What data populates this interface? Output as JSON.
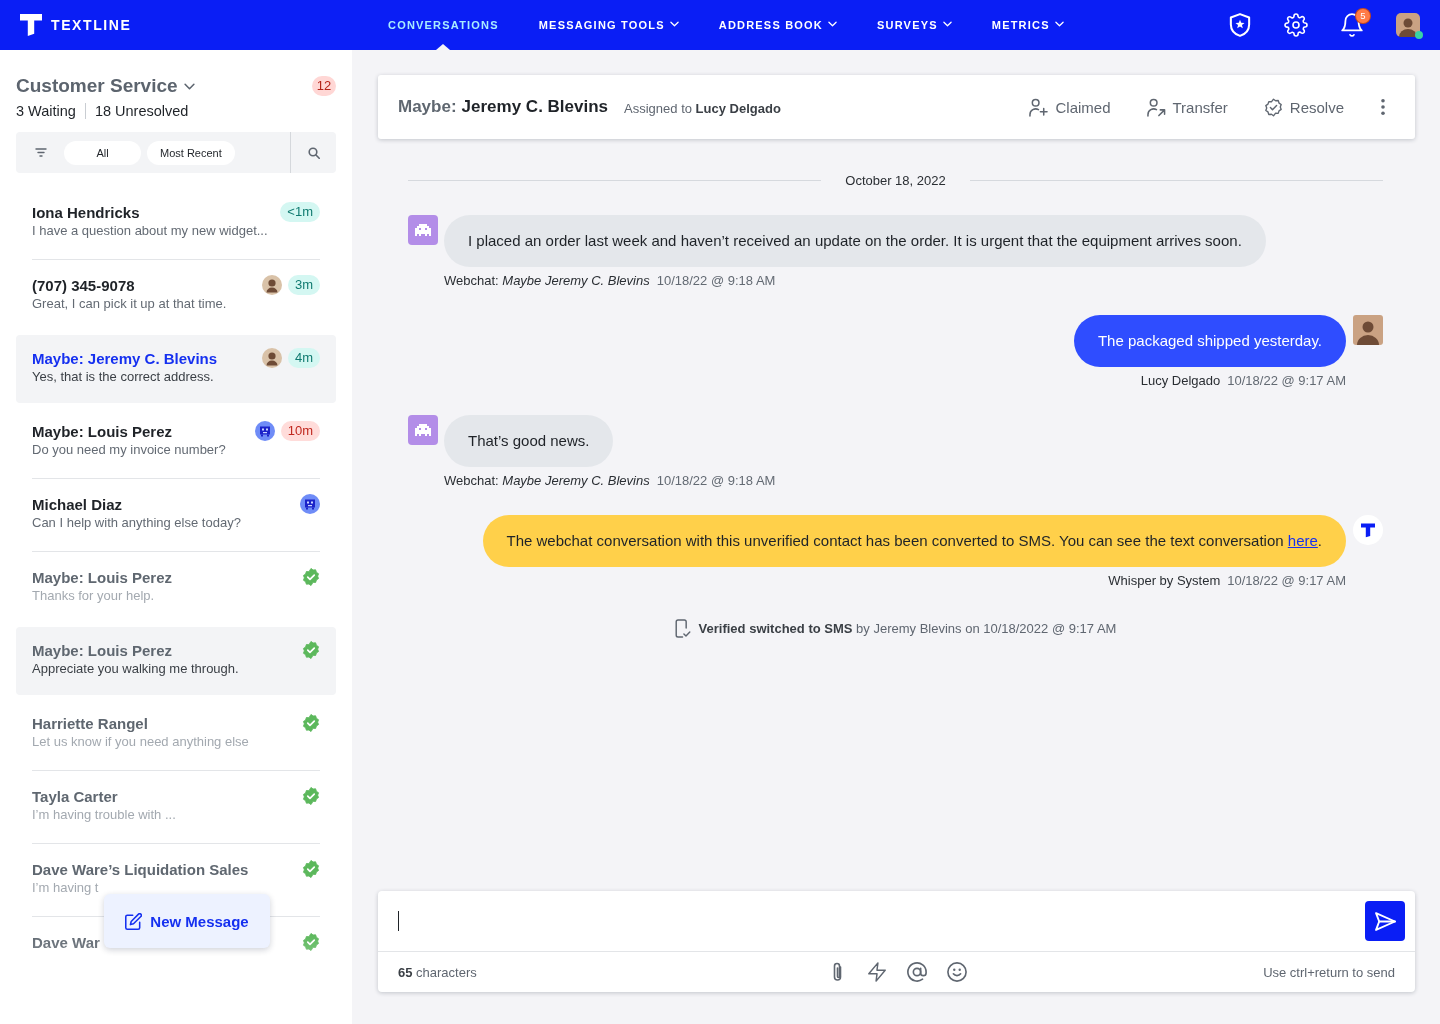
{
  "topbar": {
    "logo": "TEXTLINE",
    "nav": [
      {
        "label": "CONVERSATIONS",
        "selected": true,
        "has_menu": false
      },
      {
        "label": "MESSAGING TOOLS",
        "selected": false,
        "has_menu": true
      },
      {
        "label": "ADDRESS BOOK",
        "selected": false,
        "has_menu": true
      },
      {
        "label": "SURVEYS",
        "selected": false,
        "has_menu": true
      },
      {
        "label": "METRICS",
        "selected": false,
        "has_menu": true
      }
    ],
    "notifications": "5",
    "user_online": true
  },
  "sidebar": {
    "inbox": "Customer Service",
    "count": "12",
    "waiting": "3 Waiting",
    "unresolved": "18 Unresolved",
    "filters": [
      "All",
      "Most Recent"
    ],
    "conversations": [
      {
        "name": "Iona Hendricks",
        "preview": "I have a question about my new widget...",
        "timer": {
          "text": "<1m",
          "overdue": false
        },
        "resolved": false,
        "selected": false,
        "hovered": false
      },
      {
        "name": "(707) 345-9078",
        "preview": "Great, I can pick it up at that time.",
        "avatar": {
          "kind": "photo"
        },
        "timer": {
          "text": "3m",
          "overdue": false
        },
        "resolved": false,
        "selected": false,
        "hovered": false
      },
      {
        "name": "Maybe: Jeremy C. Blevins",
        "preview": "Yes, that is the correct address.",
        "avatar": {
          "kind": "photo"
        },
        "timer": {
          "text": "4m",
          "overdue": false
        },
        "resolved": false,
        "selected": true,
        "hovered": false
      },
      {
        "name": "Maybe: Louis Perez",
        "preview": "Do you need my invoice number?",
        "avatar": {
          "kind": "bot"
        },
        "timer": {
          "text": "10m",
          "overdue": true
        },
        "resolved": false,
        "selected": false,
        "hovered": false
      },
      {
        "name": "Michael Diaz",
        "preview": "Can I help with anything else today?",
        "avatar": {
          "kind": "bot"
        },
        "resolved": false,
        "selected": false,
        "hovered": false
      },
      {
        "name": "Maybe: Louis Perez",
        "preview": "Thanks for your help.",
        "resolved": true,
        "selected": false,
        "hovered": false
      },
      {
        "name": "Maybe: Louis Perez",
        "preview": "Appreciate you walking me through.",
        "resolved": true,
        "selected": false,
        "hovered": true
      },
      {
        "name": "Harriette Rangel",
        "preview": "Let us know if you need anything else",
        "resolved": true,
        "selected": false,
        "hovered": false
      },
      {
        "name": "Tayla Carter",
        "preview": "I’m having trouble with ...",
        "resolved": true,
        "selected": false,
        "hovered": false
      },
      {
        "name": "Dave Ware’s Liquidation Sales",
        "preview": "I’m having t",
        "resolved": true,
        "selected": false,
        "hovered": false
      },
      {
        "name": "Dave War",
        "resolved": true,
        "selected": false,
        "hovered": false
      }
    ],
    "new_message": "New Message"
  },
  "conversation": {
    "prefix": "Maybe:",
    "name": "Jeremy C. Blevins",
    "assigned": "Assigned to **Lucy Delgado**",
    "actions": [
      {
        "kind": "claim",
        "label": "Claimed"
      },
      {
        "kind": "transfer",
        "label": "Transfer"
      },
      {
        "kind": "resolve",
        "label": "Resolve"
      }
    ],
    "date": "October 18, 2022",
    "messages": [
      {
        "kind": "incoming",
        "text": "I placed an order last week and haven’t received an update on the order. It is urgent that the equipment arrives soon.",
        "sender": "Webchat: *Maybe Jeremy C. Blevins*",
        "time": "10/18/22 @ 9:18 AM"
      },
      {
        "kind": "outgoing",
        "text": "The packaged shipped yesterday.",
        "sender": "Lucy Delgado",
        "time": "10/18/22 @ 9:17 AM"
      },
      {
        "kind": "incoming",
        "text": "That’s good news.",
        "sender": "Webchat: *Maybe Jeremy C. Blevins*",
        "time": "10/18/22 @ 9:18 AM"
      },
      {
        "kind": "whisper",
        "text": "The webchat conversation with this unverified contact has been converted to SMS. You can see the text conversation",
        "link": "here",
        "text_after": ".",
        "sender": "Whisper by System",
        "time": "10/18/22 @ 9:17 AM"
      },
      {
        "kind": "event",
        "text": "**Verified switched to SMS** by Jeremy Blevins on 10/18/2022 @ 9:17 AM"
      }
    ]
  },
  "composer": {
    "count": "**65** characters",
    "hint": "Use ctrl+return to send"
  }
}
